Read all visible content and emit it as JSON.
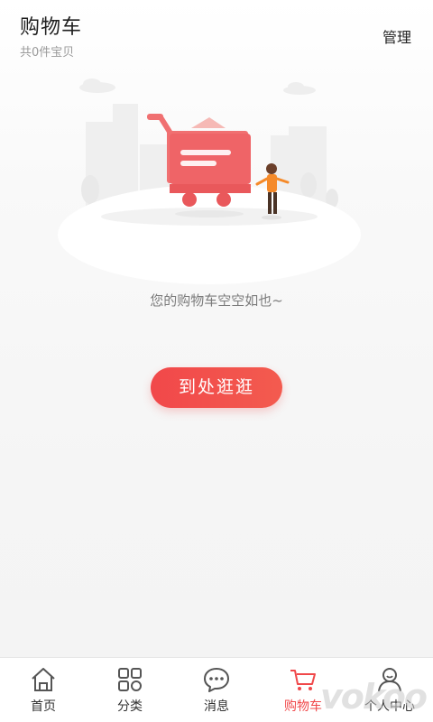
{
  "header": {
    "title": "购物车",
    "count_text": "共0件宝贝",
    "manage_label": "管理"
  },
  "empty_state": {
    "message": "您的购物车空空如也~",
    "button_label": "到处逛逛"
  },
  "tabbar": {
    "tabs": [
      {
        "label": "首页",
        "icon": "home-icon",
        "active": false
      },
      {
        "label": "分类",
        "icon": "category-grid-icon",
        "active": false
      },
      {
        "label": "消息",
        "icon": "message-bubble-icon",
        "active": false
      },
      {
        "label": "购物车",
        "icon": "cart-icon",
        "active": true
      },
      {
        "label": "个人中心",
        "icon": "profile-icon",
        "active": false
      }
    ]
  },
  "watermark": "vokoo",
  "colors": {
    "accent": "#f0484a",
    "text_primary": "#1f1f1f",
    "text_secondary": "#9a9a9a",
    "tab_inactive": "#555555"
  }
}
